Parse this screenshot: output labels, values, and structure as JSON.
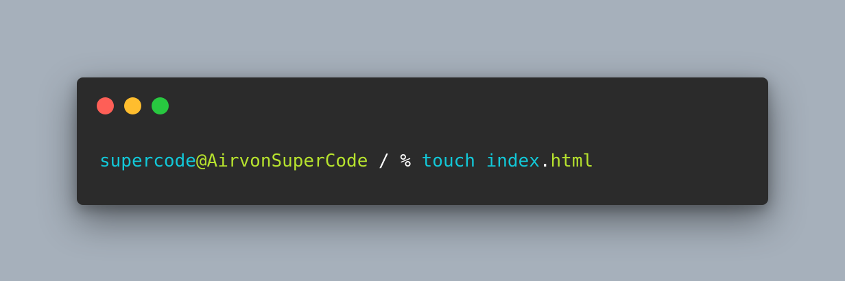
{
  "window": {
    "controls": [
      {
        "name": "close",
        "color": "#fe5f57"
      },
      {
        "name": "minimize",
        "color": "#ffbd2e"
      },
      {
        "name": "maximize",
        "color": "#28c840"
      }
    ]
  },
  "terminal": {
    "prompt": {
      "user": "supercode",
      "at": "@",
      "host": "AirvonSuperCode",
      "path": "/",
      "symbol": "%"
    },
    "command": {
      "name": "touch",
      "arg_base": "index",
      "arg_dot": ".",
      "arg_ext": "html"
    }
  },
  "colors": {
    "cyan": "#12c8d8",
    "green": "#b6e22e",
    "white": "#ffffff",
    "background": "#2b2b2b"
  }
}
